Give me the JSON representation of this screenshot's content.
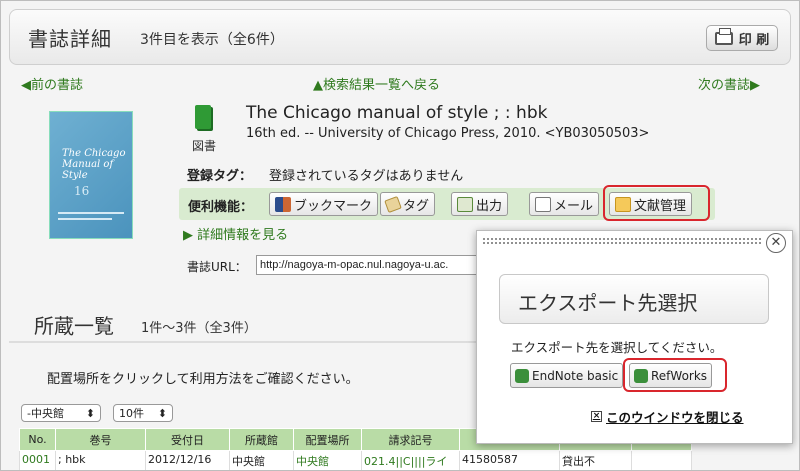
{
  "header": {
    "title": "書誌詳細",
    "count": "3件目を表示（全6件）",
    "print_label": "印 刷",
    "print_icon": "printer-icon"
  },
  "nav": {
    "prev": "◀前の書誌",
    "back": "▲検索結果一覧へ戻る",
    "next": "次の書誌▶"
  },
  "cover": {
    "line1": "The Chicago",
    "line2": "Manual of",
    "line3": "Style",
    "line4": "16"
  },
  "book": {
    "type": "図書",
    "title": "The Chicago manual of style ; : hbk",
    "publication": "16th ed. -- University of Chicago Press, 2010. <YB03050503>"
  },
  "tags": {
    "label": "登録タグ：",
    "value": "登録されているタグはありません"
  },
  "tools": {
    "label": "便利機能：",
    "bookmark": "ブックマーク",
    "tag": "タグ",
    "output": "出力",
    "mail": "メール",
    "reference": "文献管理"
  },
  "detail_link": "▶ 詳細情報を見る",
  "url": {
    "label": "書誌URL：",
    "value": "http://nagoya-m-opac.nul.nagoya-u.ac."
  },
  "holdings": {
    "title": "所蔵一覧",
    "count": "1件〜3件（全3件）",
    "instruction": "配置場所をクリックして利用方法をご確認ください。",
    "library_select": "-中央館",
    "per_page_select": "10件",
    "columns": [
      "No.",
      "巻号",
      "受付日",
      "所蔵館",
      "配置場所",
      "請求記号",
      "",
      "",
      ""
    ],
    "row1": [
      "0001",
      "; hbk",
      "2012/12/16",
      "中央館",
      "中央館",
      "021.4||C||||ライ",
      "41580587",
      "貸出不",
      ""
    ]
  },
  "popup": {
    "title": "エクスポート先選択",
    "message": "エクスポート先を選択してください。",
    "endnote": "EndNote basic",
    "refworks": "RefWorks",
    "close_window": "このウインドウを閉じる",
    "close_symbol": "✕",
    "x_symbol": "×"
  },
  "colors": {
    "link_green": "#2f7a1e",
    "highlight_red": "#d9262d",
    "toolbar_bg": "#d9ebd0",
    "table_header": "#b9dca6"
  }
}
